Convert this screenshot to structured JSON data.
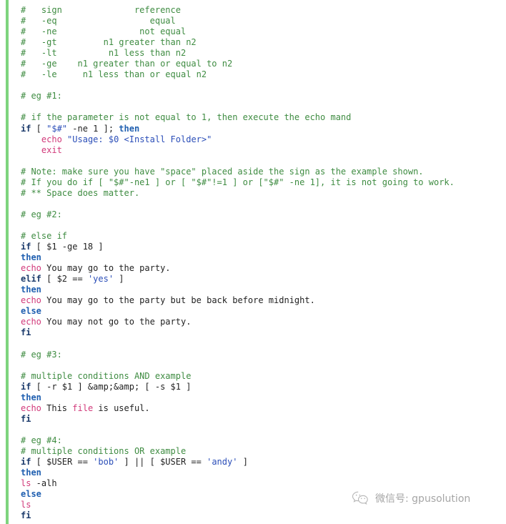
{
  "meta": {
    "language": "bash",
    "accent_stripe_color": "#7ed47e",
    "background_color": "#ffffff"
  },
  "theme": {
    "comment_color": "#3f8c42",
    "keyword_color": "#1b3a6b",
    "keyword_alt_color": "#1f5fb0",
    "builtin_color": "#d1397a",
    "string_color": "#2b4eb8",
    "plain_color": "#222222"
  },
  "code": {
    "lines": [
      {
        "tokens": [
          {
            "t": "#   sign              reference",
            "c": "cmt"
          }
        ]
      },
      {
        "tokens": [
          {
            "t": "#   -eq                  equal",
            "c": "cmt"
          }
        ]
      },
      {
        "tokens": [
          {
            "t": "#   -ne                not equal",
            "c": "cmt"
          }
        ]
      },
      {
        "tokens": [
          {
            "t": "#   -gt         n1 greater than n2",
            "c": "cmt"
          }
        ]
      },
      {
        "tokens": [
          {
            "t": "#   -lt          n1 less than n2",
            "c": "cmt"
          }
        ]
      },
      {
        "tokens": [
          {
            "t": "#   -ge    n1 greater than or equal to n2",
            "c": "cmt"
          }
        ]
      },
      {
        "tokens": [
          {
            "t": "#   -le     n1 less than or equal n2",
            "c": "cmt"
          }
        ]
      },
      {
        "tokens": []
      },
      {
        "tokens": [
          {
            "t": "# eg #1:",
            "c": "cmt"
          }
        ]
      },
      {
        "tokens": []
      },
      {
        "tokens": [
          {
            "t": "# if the parameter is not equal to 1, then execute the echo mand",
            "c": "cmt"
          }
        ]
      },
      {
        "tokens": [
          {
            "t": "if",
            "c": "kw"
          },
          {
            "t": " [ ",
            "c": "pln"
          },
          {
            "t": "\"$#\"",
            "c": "str"
          },
          {
            "t": " -ne 1 ]; ",
            "c": "pln"
          },
          {
            "t": "then",
            "c": "kw2"
          }
        ]
      },
      {
        "tokens": [
          {
            "t": "    ",
            "c": "pln"
          },
          {
            "t": "echo",
            "c": "fn"
          },
          {
            "t": " ",
            "c": "pln"
          },
          {
            "t": "\"Usage: $0 <Install Folder>\"",
            "c": "str"
          }
        ]
      },
      {
        "tokens": [
          {
            "t": "    ",
            "c": "pln"
          },
          {
            "t": "exit",
            "c": "fn"
          }
        ]
      },
      {
        "tokens": []
      },
      {
        "tokens": [
          {
            "t": "# Note: make sure you have \"space\" placed aside the sign as the example shown.",
            "c": "cmt"
          }
        ]
      },
      {
        "tokens": [
          {
            "t": "# If you do if [ \"$#\"-ne1 ] or [ \"$#\"!=1 ] or [\"$#\" -ne 1], it is not going to work.",
            "c": "cmt"
          }
        ]
      },
      {
        "tokens": [
          {
            "t": "# ** Space does matter.",
            "c": "cmt"
          }
        ]
      },
      {
        "tokens": []
      },
      {
        "tokens": [
          {
            "t": "# eg #2:",
            "c": "cmt"
          }
        ]
      },
      {
        "tokens": []
      },
      {
        "tokens": [
          {
            "t": "# else if",
            "c": "cmt"
          }
        ]
      },
      {
        "tokens": [
          {
            "t": "if",
            "c": "kw"
          },
          {
            "t": " [ $1 -ge 18 ]",
            "c": "pln"
          }
        ]
      },
      {
        "tokens": [
          {
            "t": "then",
            "c": "kw2"
          }
        ]
      },
      {
        "tokens": [
          {
            "t": "echo",
            "c": "fn"
          },
          {
            "t": " You may go to the party.",
            "c": "pln"
          }
        ]
      },
      {
        "tokens": [
          {
            "t": "elif",
            "c": "kw"
          },
          {
            "t": " [ $2 == ",
            "c": "pln"
          },
          {
            "t": "'yes'",
            "c": "str"
          },
          {
            "t": " ]",
            "c": "pln"
          }
        ]
      },
      {
        "tokens": [
          {
            "t": "then",
            "c": "kw2"
          }
        ]
      },
      {
        "tokens": [
          {
            "t": "echo",
            "c": "fn"
          },
          {
            "t": " You may go to the party but be back before midnight.",
            "c": "pln"
          }
        ]
      },
      {
        "tokens": [
          {
            "t": "else",
            "c": "kw2"
          }
        ]
      },
      {
        "tokens": [
          {
            "t": "echo",
            "c": "fn"
          },
          {
            "t": " You may not go to the party.",
            "c": "pln"
          }
        ]
      },
      {
        "tokens": [
          {
            "t": "fi",
            "c": "kw"
          }
        ]
      },
      {
        "tokens": []
      },
      {
        "tokens": [
          {
            "t": "# eg #3:",
            "c": "cmt"
          }
        ]
      },
      {
        "tokens": []
      },
      {
        "tokens": [
          {
            "t": "# multiple conditions AND example",
            "c": "cmt"
          }
        ]
      },
      {
        "tokens": [
          {
            "t": "if",
            "c": "kw"
          },
          {
            "t": " [ -r $1 ] &amp;&amp; [ -s $1 ]",
            "c": "pln"
          }
        ]
      },
      {
        "tokens": [
          {
            "t": "then",
            "c": "kw2"
          }
        ]
      },
      {
        "tokens": [
          {
            "t": "echo",
            "c": "fn"
          },
          {
            "t": " This ",
            "c": "pln"
          },
          {
            "t": "file",
            "c": "fn"
          },
          {
            "t": " is useful.",
            "c": "pln"
          }
        ]
      },
      {
        "tokens": [
          {
            "t": "fi",
            "c": "kw"
          }
        ]
      },
      {
        "tokens": []
      },
      {
        "tokens": [
          {
            "t": "# eg #4:",
            "c": "cmt"
          }
        ]
      },
      {
        "tokens": [
          {
            "t": "# multiple conditions OR example",
            "c": "cmt"
          }
        ]
      },
      {
        "tokens": [
          {
            "t": "if",
            "c": "kw"
          },
          {
            "t": " [ $USER == ",
            "c": "pln"
          },
          {
            "t": "'bob'",
            "c": "str"
          },
          {
            "t": " ] || [ $USER == ",
            "c": "pln"
          },
          {
            "t": "'andy'",
            "c": "str"
          },
          {
            "t": " ]",
            "c": "pln"
          }
        ]
      },
      {
        "tokens": [
          {
            "t": "then",
            "c": "kw2"
          }
        ]
      },
      {
        "tokens": [
          {
            "t": "ls",
            "c": "fn"
          },
          {
            "t": " -alh",
            "c": "pln"
          }
        ]
      },
      {
        "tokens": [
          {
            "t": "else",
            "c": "kw2"
          }
        ]
      },
      {
        "tokens": [
          {
            "t": "ls",
            "c": "fn"
          }
        ]
      },
      {
        "tokens": [
          {
            "t": "fi",
            "c": "kw"
          }
        ]
      }
    ]
  },
  "watermark": {
    "icon": "wechat-icon",
    "text": "微信号: gpusolution"
  }
}
